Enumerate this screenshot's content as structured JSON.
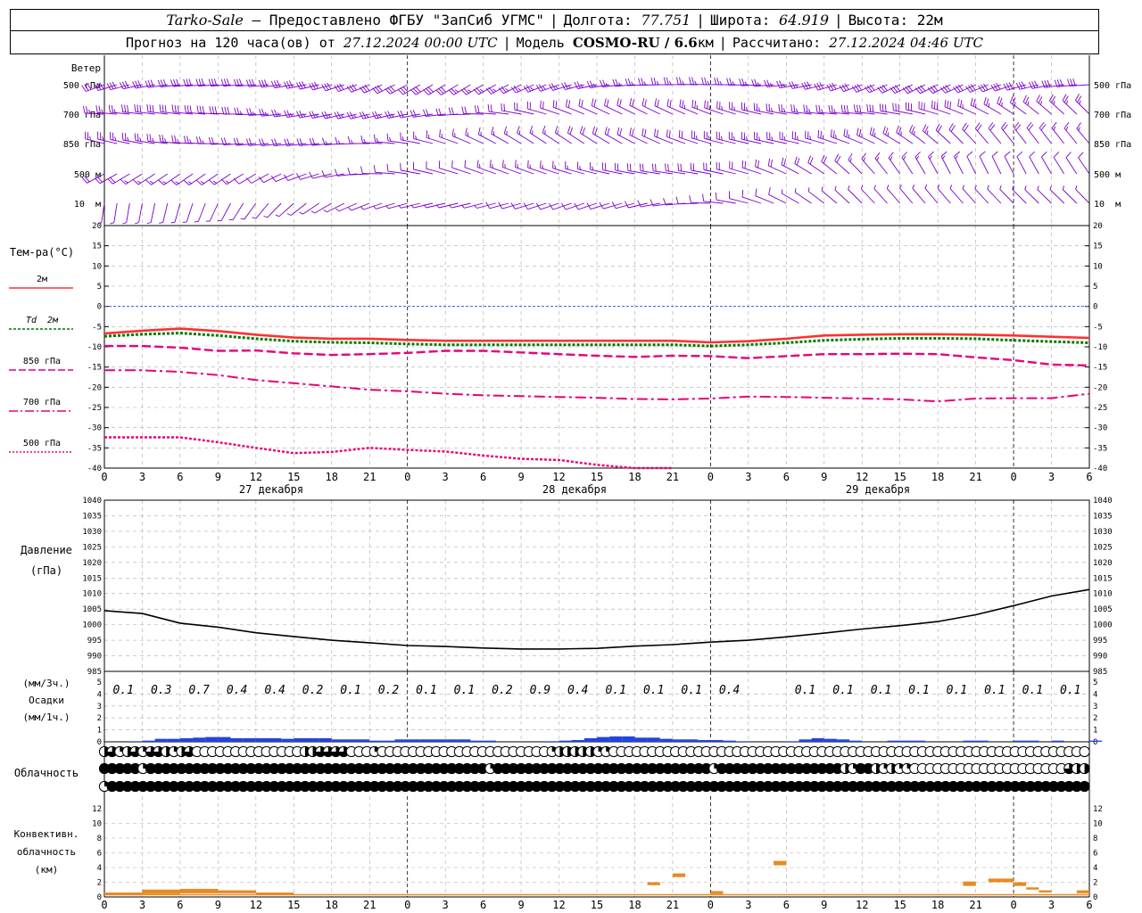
{
  "header": {
    "station": "Tarko-Sale",
    "dash": " – ",
    "provider": "Предоставлено ФГБУ \"ЗапСиб УГМС\"",
    "lon_label": "Долгота:",
    "lon": "77.751",
    "lat_label": "Широта:",
    "lat": "64.919",
    "alt_label": "Высота:",
    "alt": "22м",
    "forecast_label": "Прогноз на 120 часа(ов) от",
    "forecast_time": "27.12.2024 00:00 UTC",
    "model_label": "Модель",
    "model": "COSMO-RU / 6.6",
    "model_unit": "км",
    "calc_label": "Рассчитано:",
    "calc_time": "27.12.2024 04:46 UTC"
  },
  "wind": {
    "title": "Ветер",
    "levels": [
      "500 гПа",
      "700 гПа",
      "850 гПа",
      "500 м",
      "10  м"
    ],
    "color": "#7b00c8"
  },
  "temperature": {
    "title": "Тем-ра(°C)",
    "legend": [
      "2м",
      "Td  2м",
      "850 гПа",
      "700 гПа",
      "500 гПа"
    ],
    "ticks": [
      "20",
      "15",
      "10",
      "5",
      "0",
      "-5",
      "-10",
      "-15",
      "-20",
      "-25",
      "-30",
      "-35",
      "-40"
    ]
  },
  "time_axis": {
    "hours": [
      "0",
      "3",
      "6",
      "9",
      "12",
      "15",
      "18",
      "21",
      "0",
      "3",
      "6",
      "9",
      "12",
      "15",
      "18",
      "21",
      "0",
      "3",
      "6",
      "9",
      "12",
      "15",
      "18",
      "21",
      "0",
      "3",
      "6"
    ],
    "dates": [
      "27 декабря",
      "28 декабря",
      "29 декабря"
    ]
  },
  "pressure": {
    "title1": "Давление",
    "title2": "(гПа)",
    "ticks": [
      "1040",
      "1035",
      "1030",
      "1025",
      "1020",
      "1015",
      "1010",
      "1005",
      "1000",
      "995",
      "990",
      "985"
    ]
  },
  "precip": {
    "title1": "(мм/3ч.)",
    "title2": "Осадки",
    "title3": "(мм/1ч.)",
    "ticks": [
      "5",
      "4",
      "3",
      "2",
      "1",
      "0"
    ],
    "labels": [
      "0.1",
      "0.3",
      "0.7",
      "0.4",
      "0.4",
      "0.2",
      "0.1",
      "0.2",
      "0.1",
      "0.1",
      "0.2",
      "0.9",
      "0.4",
      "0.1",
      "0.1",
      "0.1",
      "0.4",
      "",
      "0.1",
      "0.1",
      "0.1",
      "0.1",
      "0.1",
      "0.1",
      "0.1",
      "0.1"
    ]
  },
  "clouds": {
    "title": "Облачность"
  },
  "convective": {
    "title1": "Конвективн.",
    "title2": "облачность",
    "title3": "(км)",
    "ticks": [
      "12",
      "10",
      "8",
      "6",
      "4",
      "2",
      "0"
    ]
  },
  "chart_data": [
    {
      "type": "line",
      "name": "temperature",
      "x": [
        0,
        3,
        6,
        9,
        12,
        15,
        18,
        21,
        24,
        27,
        30,
        33,
        36,
        39,
        42,
        45,
        48,
        51,
        54,
        57,
        60,
        63,
        66,
        69,
        72,
        75,
        78
      ],
      "ylim": [
        -40,
        20
      ],
      "series": [
        {
          "name": "2м",
          "color": "#ff3030",
          "values": [
            -6.7,
            -6.0,
            -5.5,
            -6.1,
            -7.0,
            -7.7,
            -8.0,
            -8.0,
            -8.3,
            -8.5,
            -8.5,
            -8.5,
            -8.5,
            -8.5,
            -8.5,
            -8.5,
            -8.9,
            -8.6,
            -8.0,
            -7.2,
            -7.0,
            -6.9,
            -6.9,
            -7.0,
            -7.2,
            -7.5,
            -7.8
          ]
        },
        {
          "name": "Td  2м",
          "color": "#007a00",
          "values": [
            -7.4,
            -6.9,
            -6.6,
            -7.2,
            -8.0,
            -8.6,
            -8.9,
            -9.0,
            -9.3,
            -9.5,
            -9.5,
            -9.5,
            -9.5,
            -9.5,
            -9.5,
            -9.5,
            -9.8,
            -9.5,
            -9.0,
            -8.4,
            -8.1,
            -7.9,
            -7.9,
            -8.0,
            -8.4,
            -8.7,
            -9.0
          ]
        },
        {
          "name": "850 гПа",
          "color": "#e8007a",
          "values": [
            -9.8,
            -9.8,
            -10.2,
            -11.0,
            -10.9,
            -11.6,
            -12.0,
            -11.8,
            -11.5,
            -11.0,
            -11.0,
            -11.4,
            -11.8,
            -12.2,
            -12.5,
            -12.2,
            -12.3,
            -12.8,
            -12.3,
            -11.8,
            -11.8,
            -11.7,
            -11.8,
            -12.6,
            -13.3,
            -14.4,
            -14.6
          ]
        },
        {
          "name": "700 гПа",
          "color": "#e8007a",
          "values": [
            -15.8,
            -15.8,
            -16.2,
            -17.0,
            -18.2,
            -19.0,
            -19.8,
            -20.6,
            -21.0,
            -21.6,
            -22.0,
            -22.2,
            -22.4,
            -22.6,
            -22.9,
            -23.0,
            -22.8,
            -22.3,
            -22.4,
            -22.6,
            -22.8,
            -23.0,
            -23.5,
            -22.8,
            -22.7,
            -22.7,
            -21.6
          ]
        },
        {
          "name": "500 гПа",
          "color": "#e8007a",
          "values": [
            -32.4,
            -32.4,
            -32.4,
            -33.6,
            -35.0,
            -36.3,
            -36.0,
            -35.0,
            -35.5,
            -35.9,
            -36.9,
            -37.7,
            -38.0,
            -39.2,
            -40.0,
            -40.5,
            null,
            null,
            null,
            null,
            null,
            null,
            null,
            null,
            null,
            null,
            null
          ]
        }
      ]
    },
    {
      "type": "line",
      "name": "pressure",
      "x": [
        0,
        3,
        6,
        9,
        12,
        15,
        18,
        21,
        24,
        27,
        30,
        33,
        36,
        39,
        42,
        45,
        48,
        51,
        54,
        57,
        60,
        63,
        66,
        69,
        72,
        75,
        78
      ],
      "ylim": [
        985,
        1040
      ],
      "series": [
        {
          "name": "Давление",
          "color": "#000000",
          "values": [
            1004.5,
            1003.6,
            1000.5,
            999.2,
            997.4,
            996.2,
            995.0,
            994.2,
            993.3,
            993.0,
            992.5,
            992.2,
            992.2,
            992.4,
            993.1,
            993.6,
            994.4,
            995.0,
            996.1,
            997.3,
            998.6,
            999.7,
            1001.0,
            1003.2,
            1006.1,
            1009.2,
            1011.3
          ]
        }
      ]
    },
    {
      "type": "bar",
      "name": "precipitation",
      "x": [
        0,
        1,
        2,
        3,
        4,
        5,
        6,
        7,
        8,
        9,
        10,
        11,
        12,
        13,
        14,
        15,
        16,
        17,
        18,
        19,
        20,
        21,
        22,
        23,
        24,
        25,
        26,
        27,
        28,
        29,
        30,
        31,
        32,
        33,
        34,
        35,
        36,
        37,
        38,
        39,
        40,
        41,
        42,
        43,
        44,
        45,
        46,
        47,
        48,
        49,
        50,
        51,
        52,
        53,
        54,
        55,
        56,
        57,
        58,
        59,
        60,
        61,
        62,
        63,
        64,
        65,
        66,
        67,
        68,
        69,
        70,
        71,
        72,
        73,
        74,
        75,
        76,
        77,
        78
      ],
      "ylim": [
        0,
        5
      ],
      "color": "#2244dd",
      "values": [
        0,
        0,
        0.05,
        0.1,
        0.25,
        0.25,
        0.3,
        0.35,
        0.4,
        0.4,
        0.3,
        0.3,
        0.3,
        0.3,
        0.25,
        0.3,
        0.3,
        0.3,
        0.2,
        0.2,
        0.2,
        0.1,
        0.1,
        0.2,
        0.2,
        0.2,
        0.2,
        0.2,
        0.2,
        0.1,
        0.1,
        0,
        0,
        0,
        0,
        0.05,
        0.1,
        0.15,
        0.3,
        0.4,
        0.45,
        0.45,
        0.35,
        0.35,
        0.25,
        0.2,
        0.2,
        0.15,
        0.15,
        0.1,
        0.05,
        0,
        0,
        0,
        0.05,
        0.2,
        0.3,
        0.25,
        0.2,
        0.1,
        0,
        0,
        0.1,
        0.1,
        0.1,
        0,
        0,
        0,
        0.1,
        0.1,
        0,
        0,
        0.1,
        0.1,
        0,
        0.1,
        0,
        0,
        0.1
      ]
    },
    {
      "type": "bar",
      "name": "convective",
      "ylim": [
        0,
        13
      ],
      "color": "#e88a20",
      "segments": [
        {
          "t0": 0,
          "t1": 3,
          "base": 0.3,
          "top": 0.6
        },
        {
          "t0": 3,
          "t1": 6,
          "base": 0.4,
          "top": 1.0
        },
        {
          "t0": 6,
          "t1": 9,
          "base": 0.5,
          "top": 1.1
        },
        {
          "t0": 9,
          "t1": 12,
          "base": 0.5,
          "top": 0.9
        },
        {
          "t0": 12,
          "t1": 15,
          "base": 0.3,
          "top": 0.6
        },
        {
          "t0": 43,
          "t1": 44,
          "base": 1.6,
          "top": 2.0
        },
        {
          "t0": 45,
          "t1": 46,
          "base": 2.7,
          "top": 3.2
        },
        {
          "t0": 48,
          "t1": 49,
          "base": 0.4,
          "top": 0.8
        },
        {
          "t0": 53,
          "t1": 54,
          "base": 4.3,
          "top": 4.9
        },
        {
          "t0": 68,
          "t1": 69,
          "base": 1.5,
          "top": 2.1
        },
        {
          "t0": 70,
          "t1": 72,
          "base": 2.0,
          "top": 2.5
        },
        {
          "t0": 72,
          "t1": 73,
          "base": 1.5,
          "top": 2.0
        },
        {
          "t0": 73,
          "t1": 74,
          "base": 1.0,
          "top": 1.3
        },
        {
          "t0": 74,
          "t1": 75,
          "base": 0.6,
          "top": 0.9
        },
        {
          "t0": 77,
          "t1": 78,
          "base": 0.5,
          "top": 0.9
        }
      ]
    },
    {
      "type": "table",
      "name": "wind_barbs",
      "x": [
        0,
        1,
        2,
        3,
        4,
        5,
        6,
        7,
        8,
        9,
        10,
        11,
        12,
        13,
        14,
        15,
        16,
        17,
        18,
        19,
        20,
        21,
        22,
        23,
        24,
        25,
        26,
        27,
        28,
        29,
        30,
        31,
        32,
        33,
        34,
        35,
        36,
        37,
        38,
        39,
        40,
        41,
        42,
        43,
        44,
        45,
        46,
        47,
        48,
        49,
        50,
        51,
        52,
        53,
        54,
        55,
        56,
        57,
        58,
        59,
        60,
        61,
        62,
        63,
        64,
        65,
        66,
        67,
        68,
        69,
        70,
        71,
        72,
        73,
        74,
        75,
        76,
        77,
        78
      ],
      "speed_range": [
        [
          25,
          30
        ],
        [
          20,
          28
        ],
        [
          15,
          25
        ],
        [
          10,
          20
        ],
        [
          3,
          10
        ]
      ],
      "note_levels": [
        "500 гПа",
        "700 гПа",
        "850 гПа",
        "500 м",
        "10  м"
      ]
    },
    {
      "type": "table",
      "name": "cloud_cover",
      "rows": [
        [
          2,
          3,
          1,
          2,
          3,
          1,
          3,
          3,
          2,
          1,
          2,
          3,
          0,
          0,
          0,
          0,
          0,
          0,
          0,
          0,
          0,
          0,
          0,
          0,
          0,
          0,
          2,
          2,
          3,
          3,
          3,
          3,
          0,
          0,
          0,
          1,
          0,
          0,
          0,
          0,
          0,
          0,
          0,
          0,
          0,
          0,
          0,
          0,
          0,
          0,
          0,
          0,
          0,
          0,
          0,
          0,
          0,
          0,
          1,
          2,
          2,
          2,
          2,
          2,
          1,
          1,
          0,
          0,
          0,
          0,
          0,
          0,
          0,
          0,
          0,
          0,
          0,
          0,
          0,
          0,
          0,
          0,
          0,
          0,
          0,
          0,
          0,
          0,
          0,
          0,
          0,
          0,
          0,
          0,
          0,
          0,
          0,
          0,
          0,
          0,
          0,
          0,
          0,
          0,
          0,
          0,
          0,
          0,
          0,
          0,
          0,
          0,
          0,
          0,
          0,
          0,
          0,
          0,
          0,
          0,
          0,
          0,
          0,
          0,
          0,
          0,
          0,
          0,
          0
        ],
        [
          4,
          4,
          4,
          4,
          4,
          1,
          4,
          4,
          4,
          4,
          4,
          4,
          4,
          4,
          4,
          4,
          4,
          4,
          4,
          4,
          4,
          4,
          4,
          4,
          4,
          4,
          4,
          4,
          4,
          4,
          4,
          4,
          4,
          4,
          4,
          4,
          4,
          4,
          4,
          4,
          4,
          4,
          4,
          4,
          4,
          4,
          4,
          4,
          4,
          4,
          1,
          4,
          4,
          4,
          4,
          4,
          4,
          4,
          4,
          4,
          4,
          4,
          4,
          4,
          4,
          4,
          4,
          4,
          4,
          4,
          4,
          4,
          4,
          4,
          4,
          4,
          4,
          4,
          4,
          1,
          4,
          4,
          4,
          4,
          4,
          4,
          4,
          4,
          4,
          4,
          4,
          4,
          4,
          4,
          4,
          4,
          2,
          1,
          4,
          4,
          2,
          1,
          2,
          1,
          1,
          0,
          0,
          0,
          0,
          0,
          0,
          0,
          0,
          0,
          0,
          0,
          0,
          0,
          0,
          0,
          0,
          0,
          0,
          0,
          0,
          3,
          2,
          2,
          1,
          2,
          1,
          0,
          0
        ],
        [
          1,
          4,
          4,
          4,
          4,
          4,
          4,
          4,
          4,
          4,
          4,
          4,
          4,
          4,
          4,
          4,
          4,
          4,
          4,
          4,
          4,
          4,
          4,
          4,
          4,
          4,
          4,
          4,
          4,
          4,
          4,
          4,
          4,
          4,
          4,
          4,
          4,
          4,
          4,
          4,
          4,
          4,
          4,
          4,
          4,
          4,
          4,
          4,
          4,
          4,
          4,
          4,
          4,
          4,
          4,
          4,
          4,
          4,
          4,
          4,
          4,
          4,
          4,
          4,
          4,
          4,
          4,
          4,
          4,
          4,
          4,
          4,
          4,
          4,
          4,
          4,
          4,
          4,
          4,
          4,
          4,
          4,
          4,
          4,
          4,
          4,
          4,
          4,
          4,
          4,
          4,
          4,
          4,
          4,
          4,
          4,
          4,
          4,
          4,
          4,
          4,
          4,
          4,
          4,
          4,
          4,
          4,
          4,
          4,
          4,
          4,
          4,
          4,
          4,
          4,
          4,
          4,
          4,
          4,
          4,
          4,
          4,
          4,
          4,
          4,
          4,
          4,
          4,
          4,
          4,
          4,
          4,
          4
        ]
      ]
    }
  ]
}
